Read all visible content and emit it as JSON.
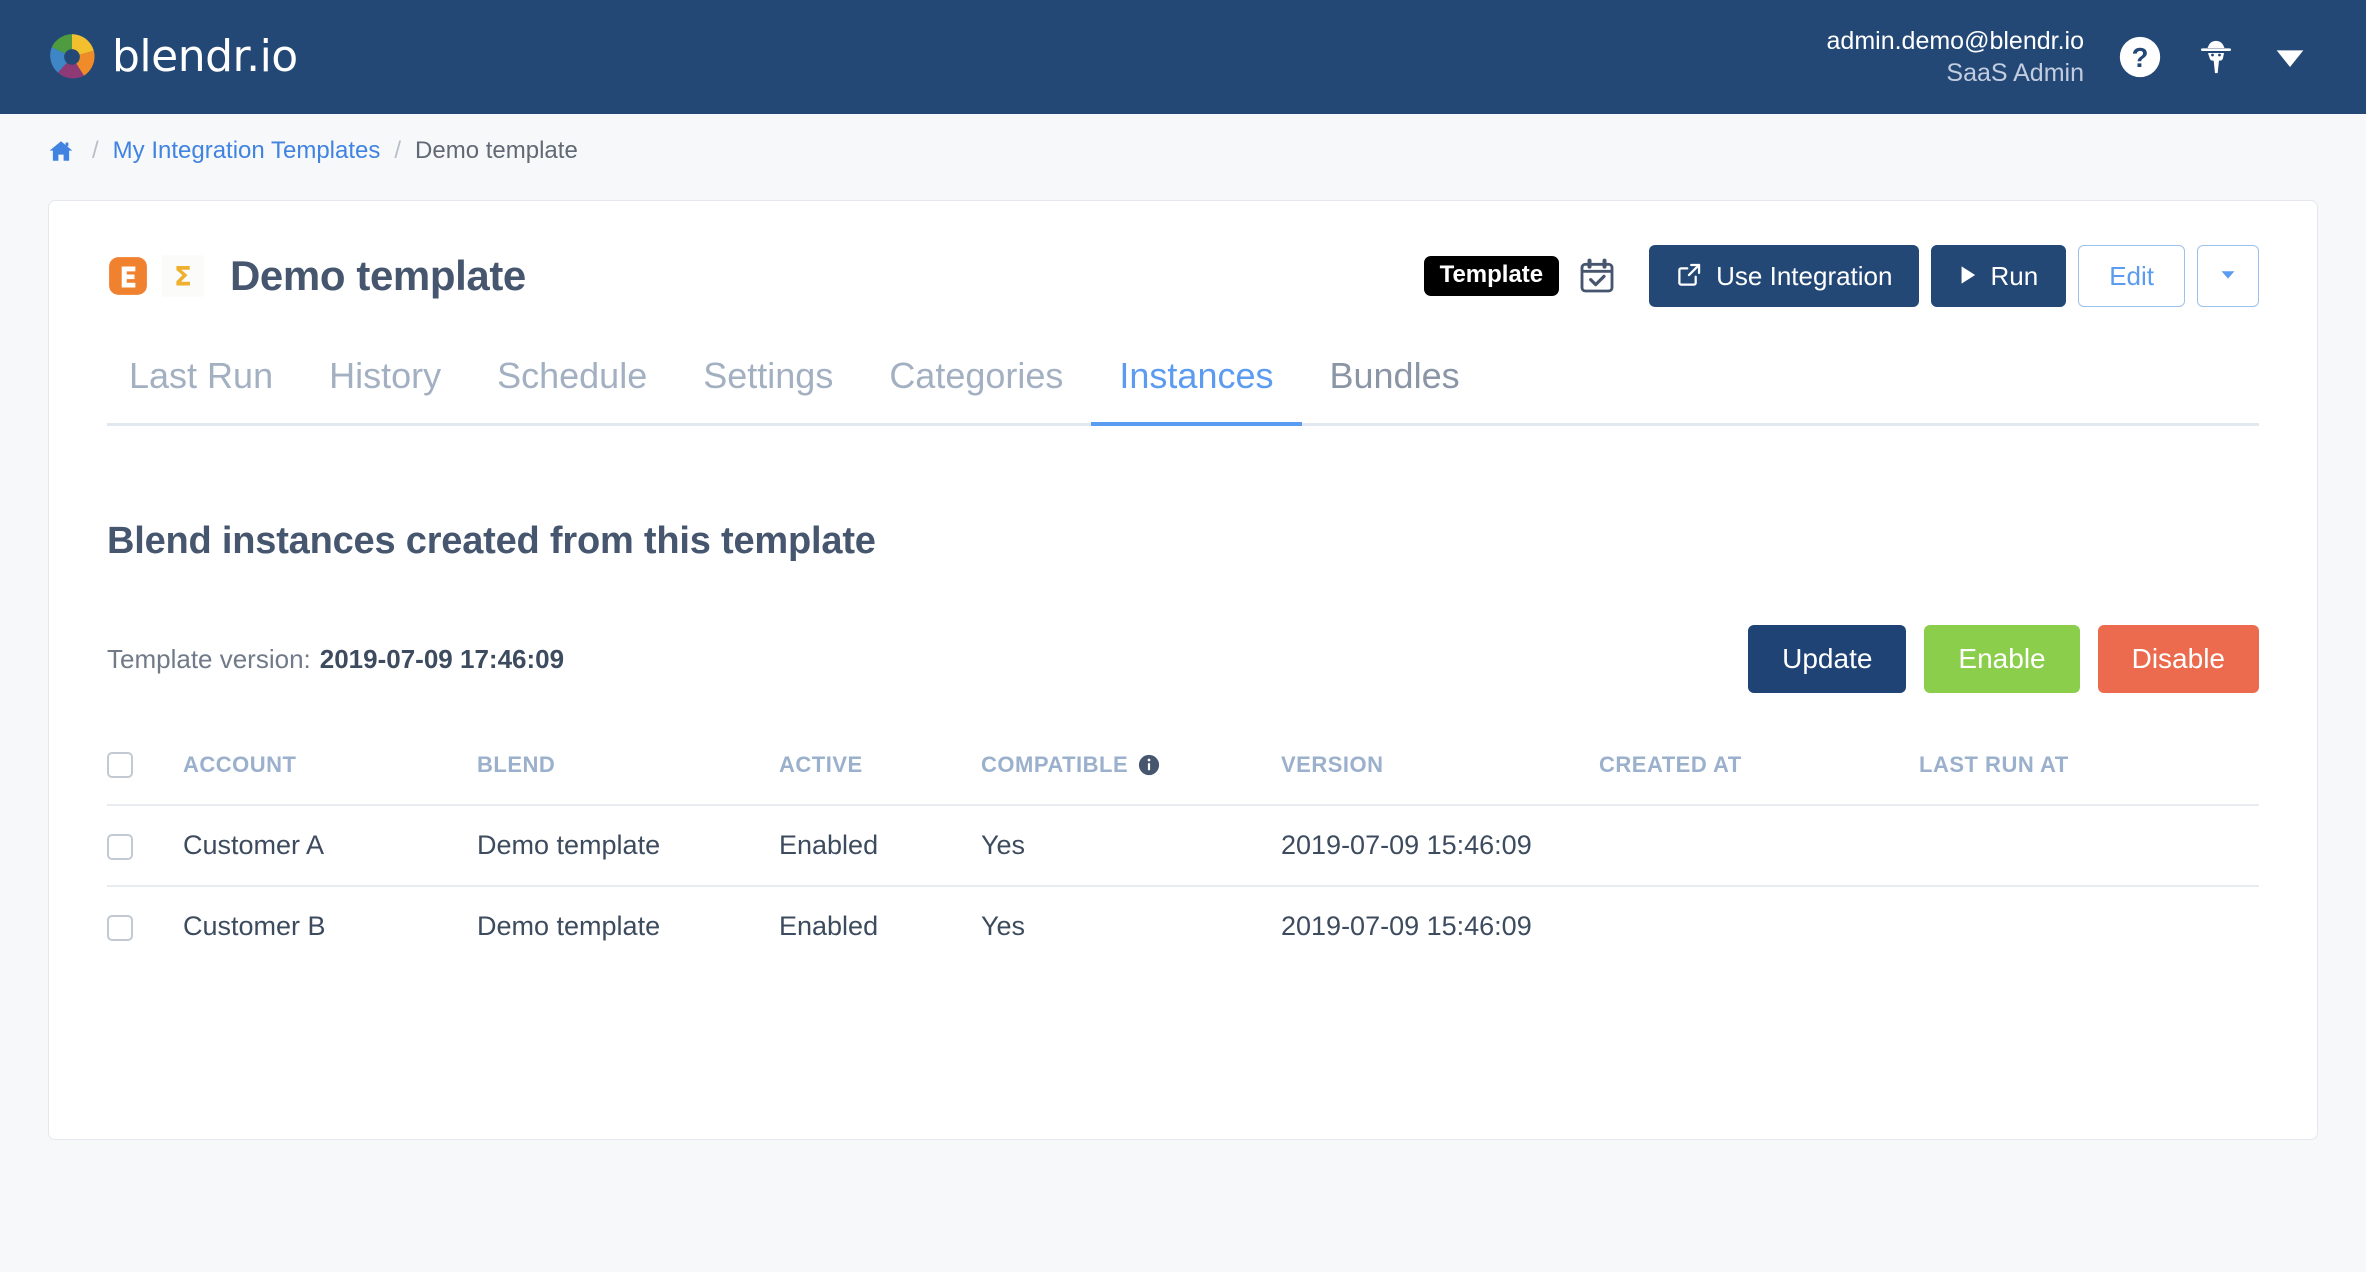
{
  "brand": {
    "name": "blendr.io",
    "logo_icon": "blendr-pinwheel-logo"
  },
  "navbar": {
    "user_email": "admin.demo@blendr.io",
    "user_role": "SaaS Admin",
    "help_icon": "question-circle-icon",
    "impersonate_icon": "user-secret-icon",
    "caret_icon": "chevron-down-icon",
    "background_color": "#234876"
  },
  "breadcrumb": {
    "home_icon": "home-icon",
    "separator": "/",
    "items": [
      {
        "label": "My Integration Templates",
        "link": true
      },
      {
        "label": "Demo template",
        "link": false
      }
    ]
  },
  "header": {
    "title": "Demo template",
    "app_icons": [
      {
        "name": "eventbrite-icon",
        "glyph": "E"
      },
      {
        "name": "sigma-icon",
        "glyph": "Σ"
      }
    ],
    "tooltip": "Template",
    "calendar_icon": "calendar-check-icon",
    "buttons": {
      "use_integration": "Use Integration",
      "use_integration_icon": "external-link-icon",
      "run": "Run",
      "run_icon": "play-icon",
      "edit": "Edit",
      "more_icon": "caret-down-icon"
    }
  },
  "tabs": [
    {
      "label": "Last Run",
      "active": false
    },
    {
      "label": "History",
      "active": false
    },
    {
      "label": "Schedule",
      "active": false
    },
    {
      "label": "Settings",
      "active": false
    },
    {
      "label": "Categories",
      "active": false
    },
    {
      "label": "Instances",
      "active": true
    },
    {
      "label": "Bundles",
      "active": false
    }
  ],
  "main": {
    "section_heading": "Blend instances created from this template",
    "version_label": "Template version:",
    "version_value": "2019-07-09 17:46:09",
    "state_buttons": {
      "update": "Update",
      "enable": "Enable",
      "disable": "Disable",
      "update_color": "#1f4375",
      "enable_color": "#8ace4b",
      "disable_color": "#ec6b4e"
    },
    "table": {
      "select_all_checkbox": "",
      "compatible_info_icon": "info-circle-icon",
      "columns": [
        "ACCOUNT",
        "BLEND",
        "ACTIVE",
        "COMPATIBLE",
        "VERSION",
        "CREATED AT",
        "LAST RUN AT"
      ],
      "rows": [
        {
          "account": "Customer A",
          "blend": "Demo template",
          "active": "Enabled",
          "compatible": "Yes",
          "version": "2019-07-09 15:46:09",
          "created_at": "",
          "last_run_at": ""
        },
        {
          "account": "Customer B",
          "blend": "Demo template",
          "active": "Enabled",
          "compatible": "Yes",
          "version": "2019-07-09 15:46:09",
          "created_at": "",
          "last_run_at": ""
        }
      ]
    }
  }
}
